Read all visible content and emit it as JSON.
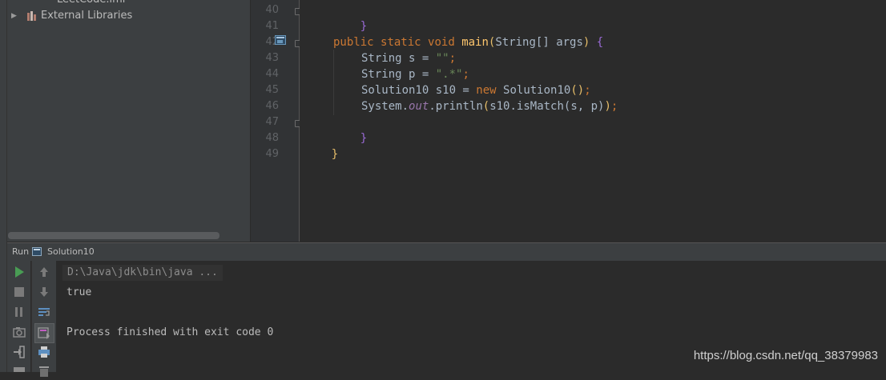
{
  "project": {
    "partial_item": "LeetCode.iml",
    "external_libraries_label": "External Libraries"
  },
  "editor": {
    "line_numbers": [
      "40",
      "41",
      "42",
      "43",
      "44",
      "45",
      "46",
      "47",
      "48",
      "49"
    ],
    "code": {
      "l40": "}",
      "l42_public": "public",
      "l42_static": "static",
      "l42_void": "void",
      "l42_main": "main",
      "l42_params": "String[] args",
      "l42_open": "{",
      "l43_decl": "String s = ",
      "l43_str": "\"\"",
      "l44_decl": "String p = ",
      "l44_str": "\".*\"",
      "l45_decl": "Solution10 s10 = ",
      "l45_new": "new",
      "l45_ctor": "Solution10",
      "l46_system": "System.",
      "l46_out": "out",
      "l46_call": ".println",
      "l46_args": "s10.isMatch(s, p)",
      "l47": "}",
      "l48": "}"
    }
  },
  "run_window": {
    "run_label": "Run",
    "config_name": "Solution10",
    "toolbar_icons": [
      "run-icon",
      "stop-icon",
      "pause-icon",
      "camera-icon",
      "exit-icon",
      "up-arrow-icon",
      "down-arrow-icon",
      "soft-wrap-icon",
      "scroll-to-end-icon",
      "print-icon",
      "trash-icon"
    ]
  },
  "console": {
    "command": "D:\\Java\\jdk\\bin\\java ...",
    "output": "true",
    "exit_message": "Process finished with exit code 0"
  },
  "watermark": "https://blog.csdn.net/qq_38379983",
  "colors": {
    "background": "#2b2b2b",
    "panel": "#3c3f41",
    "keyword": "#cc7832",
    "function": "#ffc66d",
    "string": "#6a8759",
    "field": "#9876aa",
    "run_green": "#499c54"
  }
}
